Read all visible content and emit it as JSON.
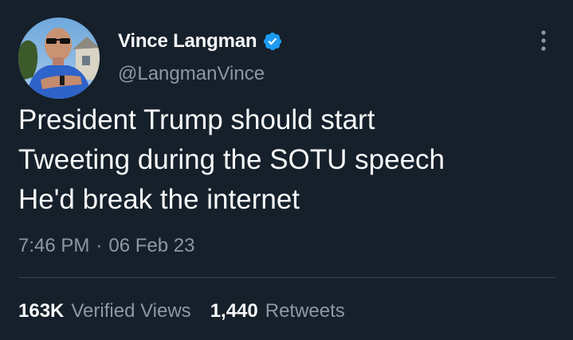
{
  "author": {
    "display_name": "Vince Langman",
    "handle": "@LangmanVince",
    "verified": true,
    "verified_color": "#1d9bf0",
    "avatar_icon": "profile-photo"
  },
  "tweet": {
    "lines": [
      "President Trump should start",
      "Tweeting during the SOTU speech",
      "He'd break the internet"
    ],
    "time": "7:46 PM",
    "separator": "·",
    "date": "06 Feb 23"
  },
  "stats": {
    "views_count": "163K",
    "views_label": "Verified Views",
    "retweets_count": "1,440",
    "retweets_label": "Retweets"
  },
  "colors": {
    "background": "#15202b",
    "text_primary": "#f7f9f9",
    "text_secondary": "#8b98a5",
    "divider": "#38444d"
  },
  "icons": {
    "more": "more-vertical-icon",
    "verified": "verified-badge-icon"
  }
}
